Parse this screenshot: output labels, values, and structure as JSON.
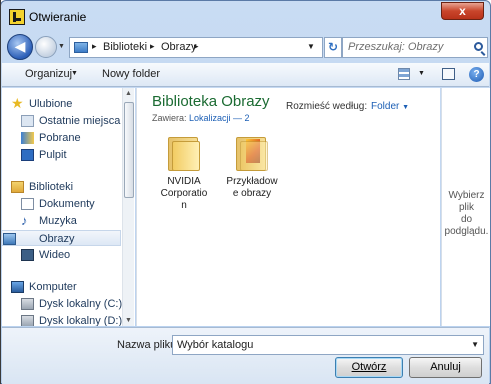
{
  "window": {
    "title": "Otwieranie",
    "close_glyph": "x"
  },
  "address_bar": {
    "crumbs": [
      "Biblioteki",
      "Obrazy"
    ],
    "separator": "▸",
    "search_placeholder": "Przeszukaj: Obrazy"
  },
  "toolbar": {
    "organize": "Organizuj",
    "new_folder": "Nowy folder",
    "dropdown_glyph": "▼"
  },
  "nav_pane": {
    "favorites_header": "Ulubione",
    "favorites": [
      "Ostatnie miejsca",
      "Pobrane",
      "Pulpit"
    ],
    "libraries_header": "Biblioteki",
    "libraries": [
      "Dokumenty",
      "Muzyka",
      "Obrazy",
      "Wideo"
    ],
    "selected": "Obrazy",
    "computer_header": "Komputer",
    "drives": [
      "Dysk lokalny (C:)",
      "Dysk lokalny (D:)"
    ]
  },
  "main_pane": {
    "library_title": "Biblioteka Obrazy",
    "contains_label": "Zawiera:",
    "locations": "Lokalizacji — 2",
    "arrange_label": "Rozmieść według:",
    "arrange_value": "Folder",
    "items": [
      {
        "name_lines": [
          "NVIDIA",
          "Corporatio",
          "n"
        ],
        "icon": "folder-icon"
      },
      {
        "name_lines": [
          "Przykładow",
          "e obrazy"
        ],
        "icon": "folder-with-photo-icon"
      }
    ]
  },
  "preview_pane": {
    "text_lines": [
      "Wybierz plik",
      "do",
      "podglądu."
    ]
  },
  "bottom": {
    "filename_label": "Nazwa pliku:",
    "filename_value": "Wybór katalogu",
    "open_button": "Otwórz",
    "cancel_button": "Anuluj"
  },
  "colors": {
    "library_title": "#1b6b32",
    "link": "#1c5fb5",
    "close_button": "#c9452b"
  }
}
